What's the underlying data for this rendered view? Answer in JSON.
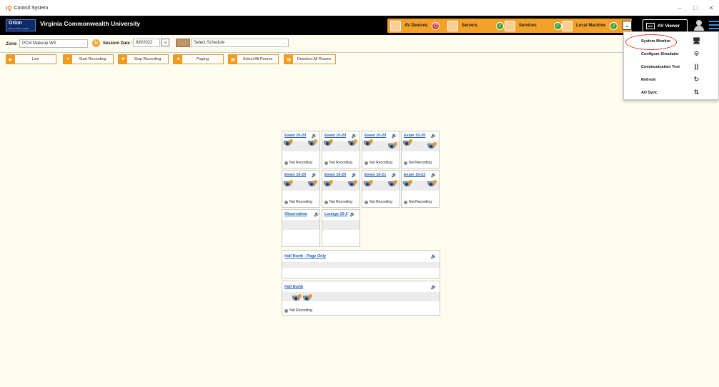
{
  "window": {
    "title": "Control System",
    "app_icon": "iQ",
    "minimize": "–",
    "maximize": "□",
    "close": "✕"
  },
  "header": {
    "logo": "Orion",
    "logo_sub": "RUN & SIMULATION",
    "university": "Virginia Commonwealth University",
    "status": [
      {
        "label": "AV Devices",
        "state": "error",
        "glyph": "☹"
      },
      {
        "label": "Servers",
        "state": "ok",
        "glyph": "✓"
      },
      {
        "label": "Services",
        "state": "ok",
        "glyph": "✓"
      },
      {
        "label": "Local Machine",
        "state": "ok",
        "glyph": "✓"
      }
    ],
    "chevron": "⌄",
    "av_viewer": "AV Viewer",
    "av_icon_text": "A/V"
  },
  "filters": {
    "zone_label": "Zone",
    "zone_value": "PCM Makeup WS",
    "session_label": "Session Date :",
    "session_value": "8/8/2022",
    "calendar_icon_text": "15",
    "schedule_value": "Select Schedule",
    "arrow": "⌄"
  },
  "toolbar": {
    "live": "Live",
    "start": "Start Recording",
    "stop": "Stop Recording",
    "paging": "Paging",
    "select_all": "Select All Rooms",
    "deselect_all": "Deselect All Rooms"
  },
  "rooms": {
    "r1": {
      "name": "Exam 10-20",
      "status": "Not Recording"
    },
    "r2": {
      "name": "Exam 10-20",
      "status": "Not Recording"
    },
    "r3": {
      "name": "Exam 10-20",
      "status": "Not Recording"
    },
    "r4": {
      "name": "Exam 10-20",
      "status": "Not Recording"
    },
    "r5": {
      "name": "Exam 10-20",
      "status": "Not Recording"
    },
    "r6": {
      "name": "Exam 10-20",
      "status": "Not Recording"
    },
    "r7": {
      "name": "Exam 10-21",
      "status": "Not Recording"
    },
    "r8": {
      "name": "Exam 10-22",
      "status": "Not Recording"
    },
    "r9": {
      "name": "Observation"
    },
    "r10": {
      "name": "Lounge 10-2"
    },
    "r11": {
      "name": "Hall North - Page Only"
    },
    "r12": {
      "name": "Hall North",
      "status": "Not Recording"
    }
  },
  "speaker_glyph": "🔊",
  "menu": {
    "items": [
      {
        "label": "System Monitor",
        "icon": "monitor-icon",
        "glyph": "🖥"
      },
      {
        "label": "Configure Simulator",
        "icon": "simulator-icon",
        "glyph": "⚙"
      },
      {
        "label": "Communication Test",
        "icon": "signal-icon",
        "glyph": "))"
      },
      {
        "label": "Refresh",
        "icon": "refresh-icon",
        "glyph": "↻"
      },
      {
        "label": "AD Sync",
        "icon": "sync-arrows-icon",
        "glyph": "⇅"
      }
    ]
  },
  "colors": {
    "accent": "#f29b1c",
    "header_bg": "#000000",
    "page_bg": "#fdfdef",
    "link": "#1f5fb5",
    "ok": "#43a335",
    "error": "#d6202e",
    "annotation": "#e03030"
  }
}
